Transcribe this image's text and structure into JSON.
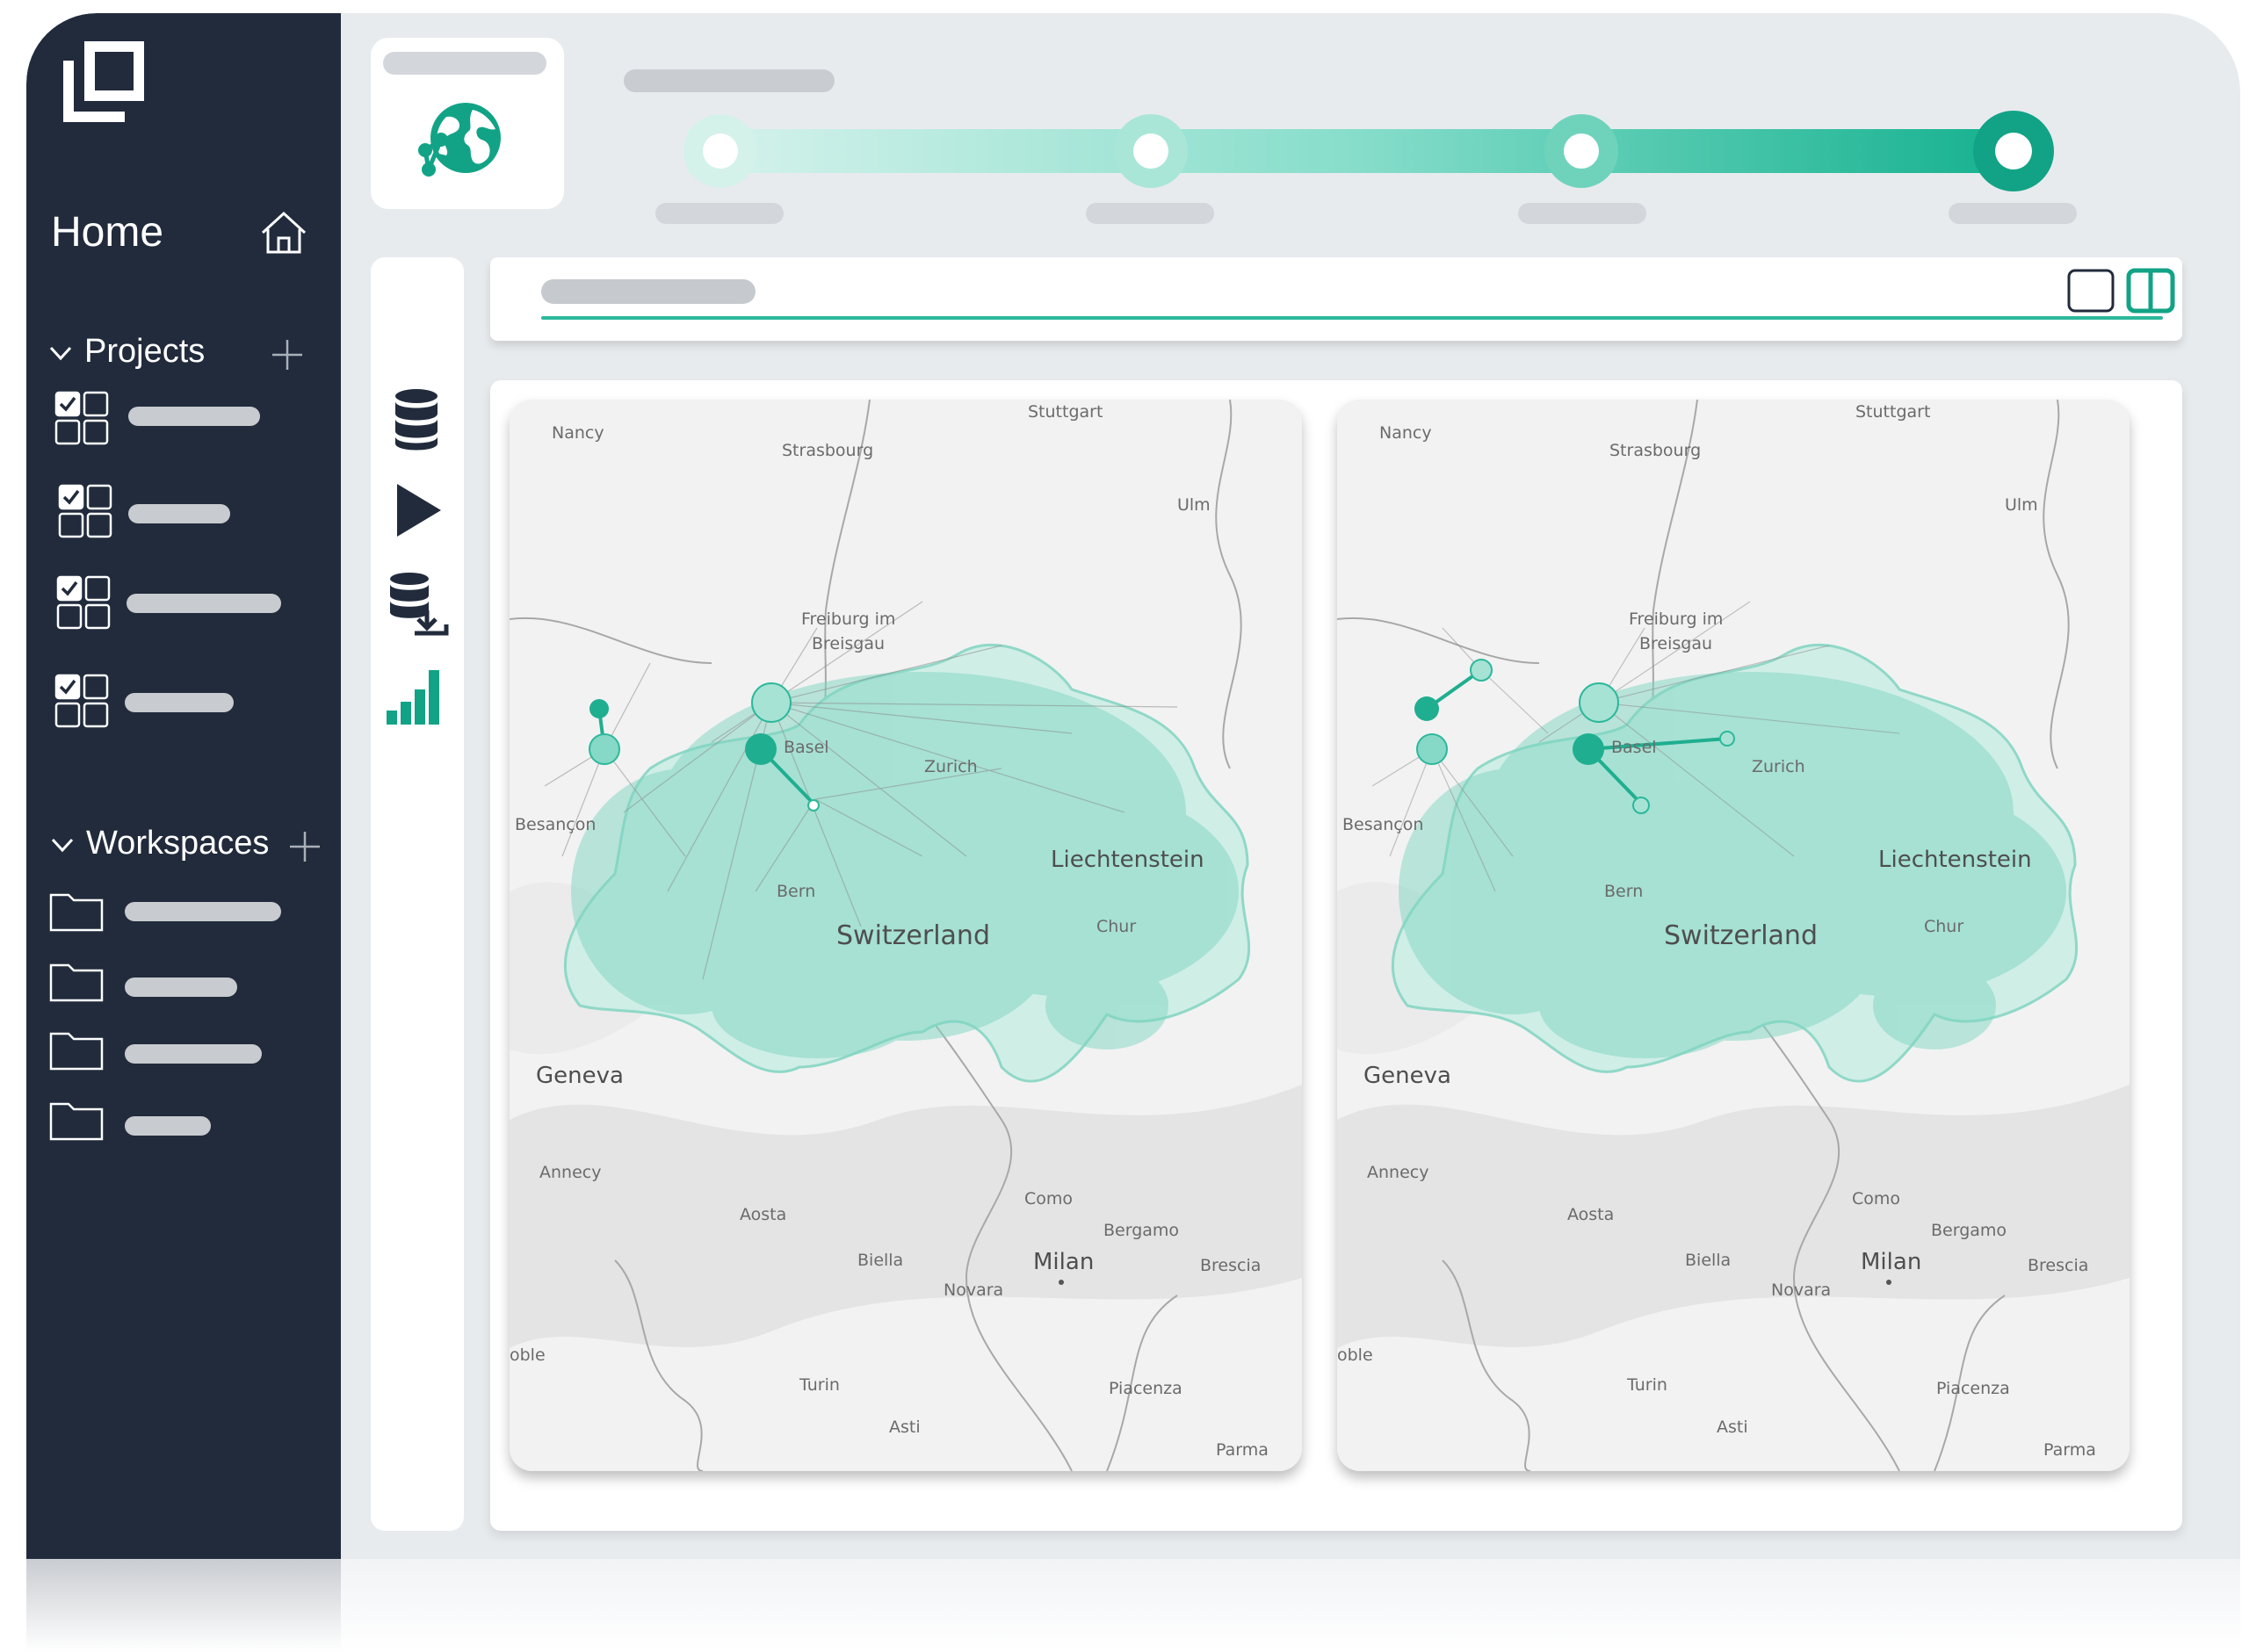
{
  "sidebar": {
    "home_label": "Home",
    "projects_label": "Projects",
    "workspaces_label": "Workspaces",
    "project_items": 4,
    "workspace_items": 4
  },
  "stepper": {
    "steps": 4,
    "current_step": 4
  },
  "layout": {
    "selected": "split"
  },
  "maps": {
    "left": {
      "country_label": "Switzerland",
      "labels": {
        "nancy": "Nancy",
        "strasbourg": "Strasbourg",
        "stuttgart": "Stuttgart",
        "ulm": "Ulm",
        "freiburg1": "Freiburg im",
        "freiburg2": "Breisgau",
        "basel": "Basel",
        "zurich": "Zurich",
        "besancon": "Besançon",
        "liechtenstein": "Liechtenstein",
        "bern": "Bern",
        "chur": "Chur",
        "geneva": "Geneva",
        "annecy": "Annecy",
        "aosta": "Aosta",
        "como": "Como",
        "bergamo": "Bergamo",
        "biella": "Biella",
        "milan": "Milan",
        "novara": "Novara",
        "brescia": "Brescia",
        "grenoble": "oble",
        "turin": "Turin",
        "piacenza": "Piacenza",
        "asti": "Asti",
        "parma": "Parma"
      }
    },
    "right": {
      "country_label": "Switzerland",
      "labels": {
        "nancy": "Nancy",
        "strasbourg": "Strasbourg",
        "stuttgart": "Stuttgart",
        "ulm": "Ulm",
        "freiburg1": "Freiburg im",
        "freiburg2": "Breisgau",
        "basel": "Basel",
        "zurich": "Zurich",
        "besancon": "Besançon",
        "liechtenstein": "Liechtenstein",
        "bern": "Bern",
        "chur": "Chur",
        "geneva": "Geneva",
        "annecy": "Annecy",
        "aosta": "Aosta",
        "como": "Como",
        "bergamo": "Bergamo",
        "biella": "Biella",
        "milan": "Milan",
        "novara": "Novara",
        "brescia": "Brescia",
        "grenoble": "oble",
        "turin": "Turin",
        "piacenza": "Piacenza",
        "asti": "Asti",
        "parma": "Parma"
      }
    }
  },
  "colors": {
    "sidebar": "#212b3c",
    "accent": "#2cb89b",
    "accent_dark": "#12a386",
    "background": "#e8ebee",
    "placeholder": "#c8cbcf"
  },
  "icons": {
    "logo": "brand-logo-icon",
    "home": "home-icon",
    "project": "checklist-grid-icon",
    "workspace": "folder-icon",
    "globe": "globe-network-icon",
    "tools": [
      "database-icon",
      "play-icon",
      "database-download-icon",
      "bar-chart-icon"
    ],
    "layout": [
      "single-panel-icon",
      "split-panel-icon"
    ]
  }
}
